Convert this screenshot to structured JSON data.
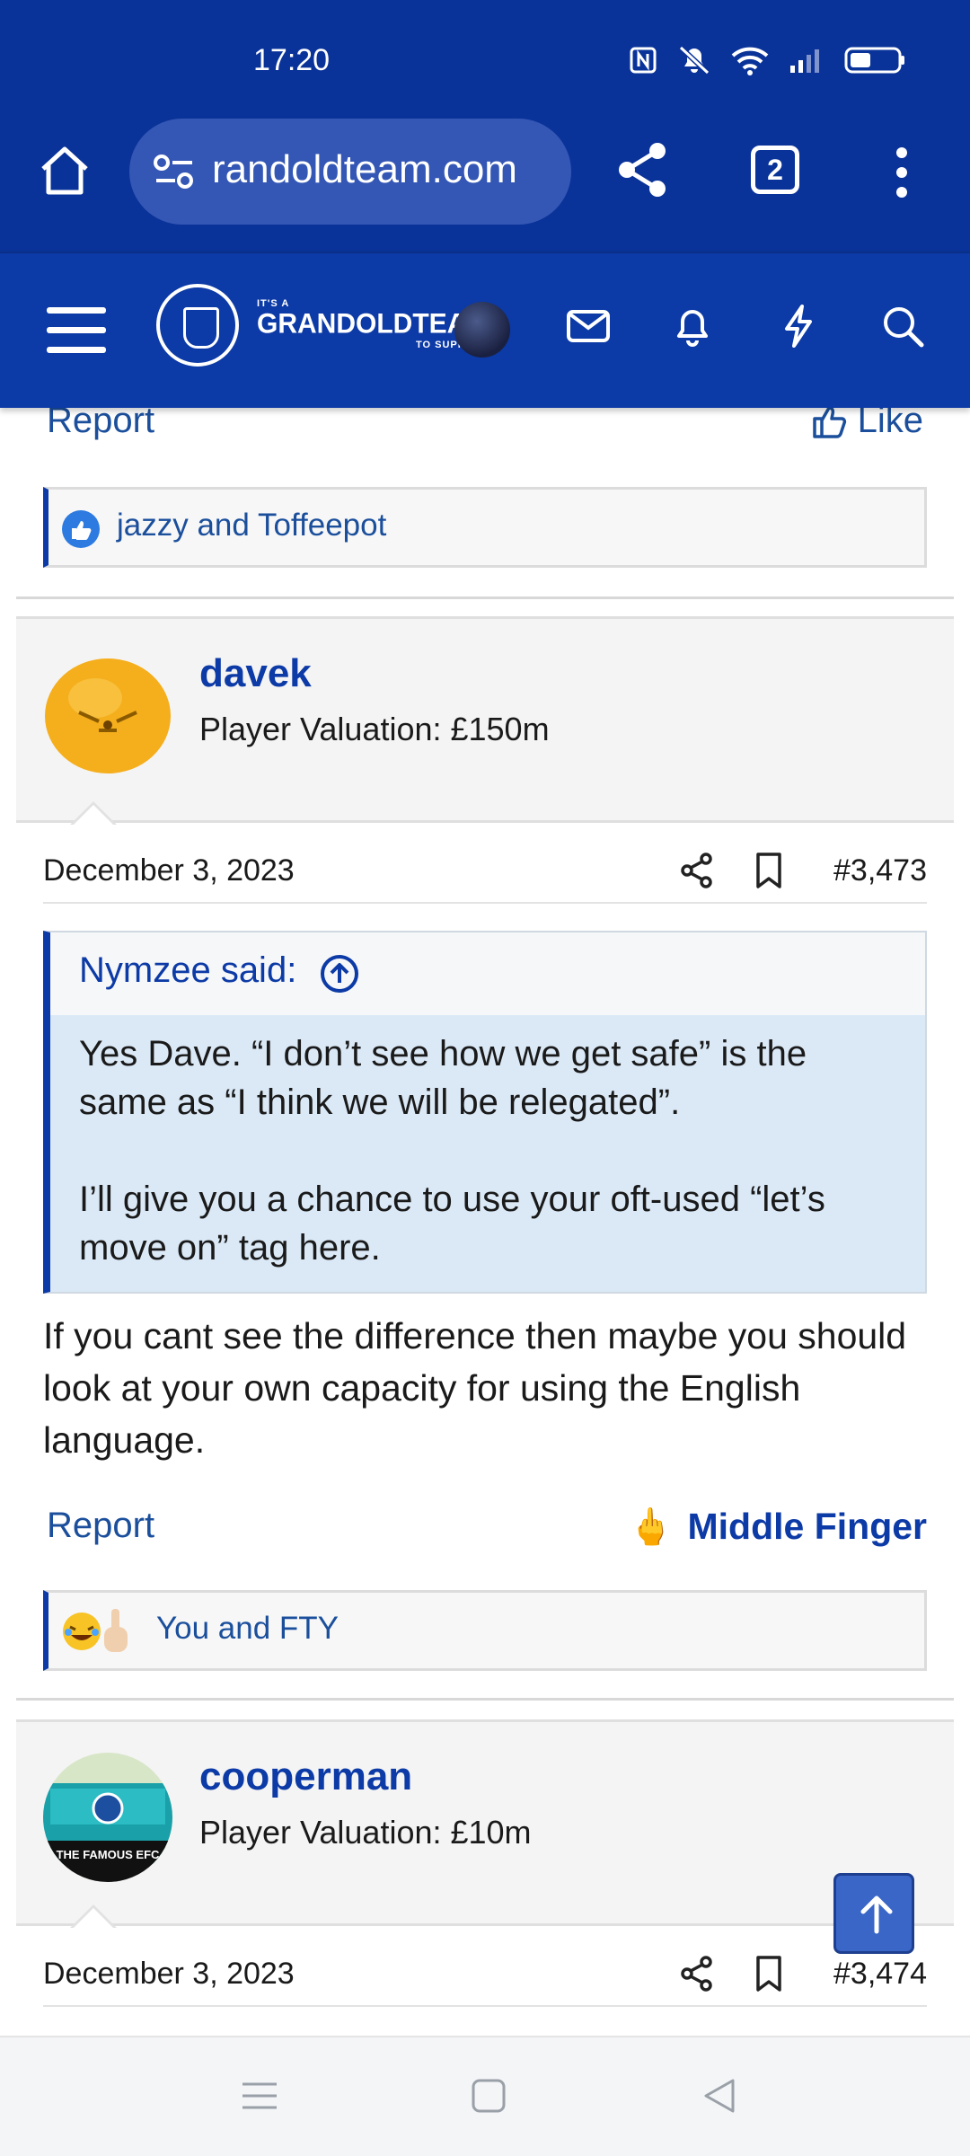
{
  "status": {
    "time": "17:20"
  },
  "browser": {
    "url": "randoldteam.com",
    "tab_count": "2"
  },
  "site": {
    "logo_small": "IT'S A",
    "logo_big": "GRANDOLDTEAM",
    "logo_tiny": "TO SUPPORT"
  },
  "prev_post": {
    "report": "Report",
    "like": "Like",
    "reactions": "jazzy and Toffeepot"
  },
  "post1": {
    "username": "davek",
    "valuation": "Player Valuation: £150m",
    "date": "December 3, 2023",
    "number": "#3,473",
    "quote_author": "Nymzee said:",
    "quote_p1": "Yes Dave. “I don’t see how we get safe” is the same as “I think we will be relegated”.",
    "quote_p2": "I’ll give you a chance to use your oft-used “let’s move on” tag here.",
    "body": "If you cant see the difference then maybe you should look at your own capacity for using the English language.",
    "report": "Report",
    "reaction_label": "Middle Finger",
    "reactions": "You and FTY"
  },
  "post2": {
    "username": "cooperman",
    "valuation": "Player Valuation: £10m",
    "avatar_caption": "THE FAMOUS EFC",
    "date": "December 3, 2023",
    "number": "#3,474"
  },
  "colors": {
    "brand": "#0c3aa6",
    "link": "#1b4f9c",
    "quote_bg": "#dbe9f7"
  }
}
